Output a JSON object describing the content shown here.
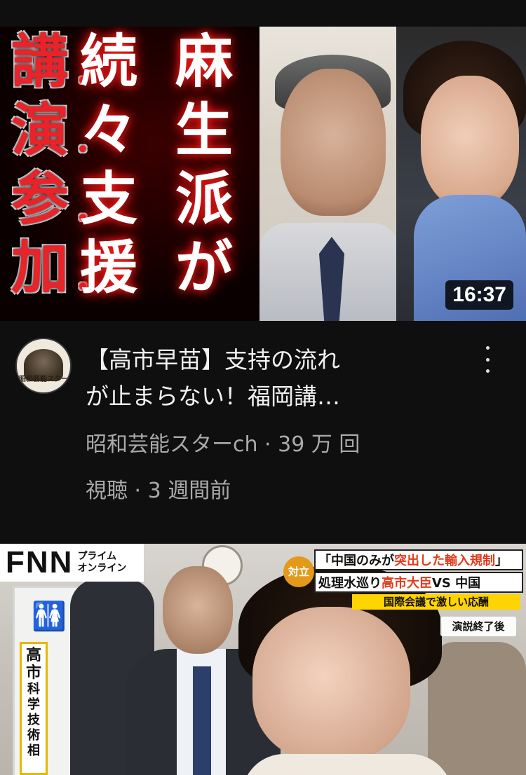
{
  "video1": {
    "thumbnail": {
      "col_red": [
        "講",
        "演",
        "参",
        "加"
      ],
      "col_mid": [
        "続",
        "々",
        "支",
        "援"
      ],
      "col_right": [
        "麻",
        "生",
        "派",
        "が"
      ],
      "dot": "・",
      "duration": "16:37"
    },
    "channel_avatar_text": "昭和芸能スター",
    "title_line1": "【高市早苗】支持の流れ",
    "title_line2": "が止まらない！福岡講…",
    "meta_line1": "昭和芸能スターch · 39 万 回",
    "meta_line2": "視聴 · 3 週間前",
    "more_icon": "vertical-ellipsis"
  },
  "video2": {
    "thumbnail": {
      "logo": "FNN",
      "logo_sub_1": "プライム",
      "logo_sub_2": "オンライン",
      "badge": "対立",
      "banner1_pre": "「中国のみが",
      "banner1_hl": "突出した輸入規制",
      "banner1_post": "」",
      "banner2_pre": "処理水巡り",
      "banner2_hl": "高市大臣",
      "banner2_post": "VS 中国",
      "banner3": "国際会議で激しい応酬",
      "after_speech": "演説終了後",
      "side_label_big": [
        "高",
        "市"
      ],
      "side_label_small": [
        "科",
        "学",
        "技",
        "術",
        "相"
      ],
      "restroom_icon": "🚻"
    }
  }
}
